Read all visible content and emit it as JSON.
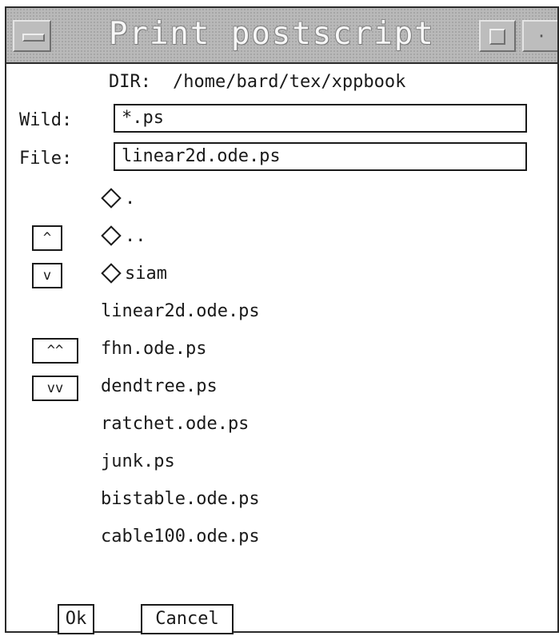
{
  "window": {
    "title": "Print postscript"
  },
  "dir": {
    "label": "DIR:",
    "path": "/home/bard/tex/xppbook"
  },
  "wild": {
    "label": "Wild:",
    "value": "*.ps"
  },
  "file": {
    "label": "File:",
    "value": "linear2d.ode.ps"
  },
  "scroll_buttons": {
    "up": "^",
    "down": "v",
    "page_up": "^^",
    "page_down": "vv"
  },
  "entries": [
    {
      "name": ".",
      "type": "directory"
    },
    {
      "name": "..",
      "type": "directory"
    },
    {
      "name": "siam",
      "type": "directory"
    },
    {
      "name": "linear2d.ode.ps",
      "type": "file"
    },
    {
      "name": "fhn.ode.ps",
      "type": "file"
    },
    {
      "name": "dendtree.ps",
      "type": "file"
    },
    {
      "name": "ratchet.ode.ps",
      "type": "file"
    },
    {
      "name": "junk.ps",
      "type": "file"
    },
    {
      "name": "bistable.ode.ps",
      "type": "file"
    },
    {
      "name": "cable100.ode.ps",
      "type": "file"
    }
  ],
  "buttons": {
    "ok": "Ok",
    "cancel": "Cancel"
  }
}
